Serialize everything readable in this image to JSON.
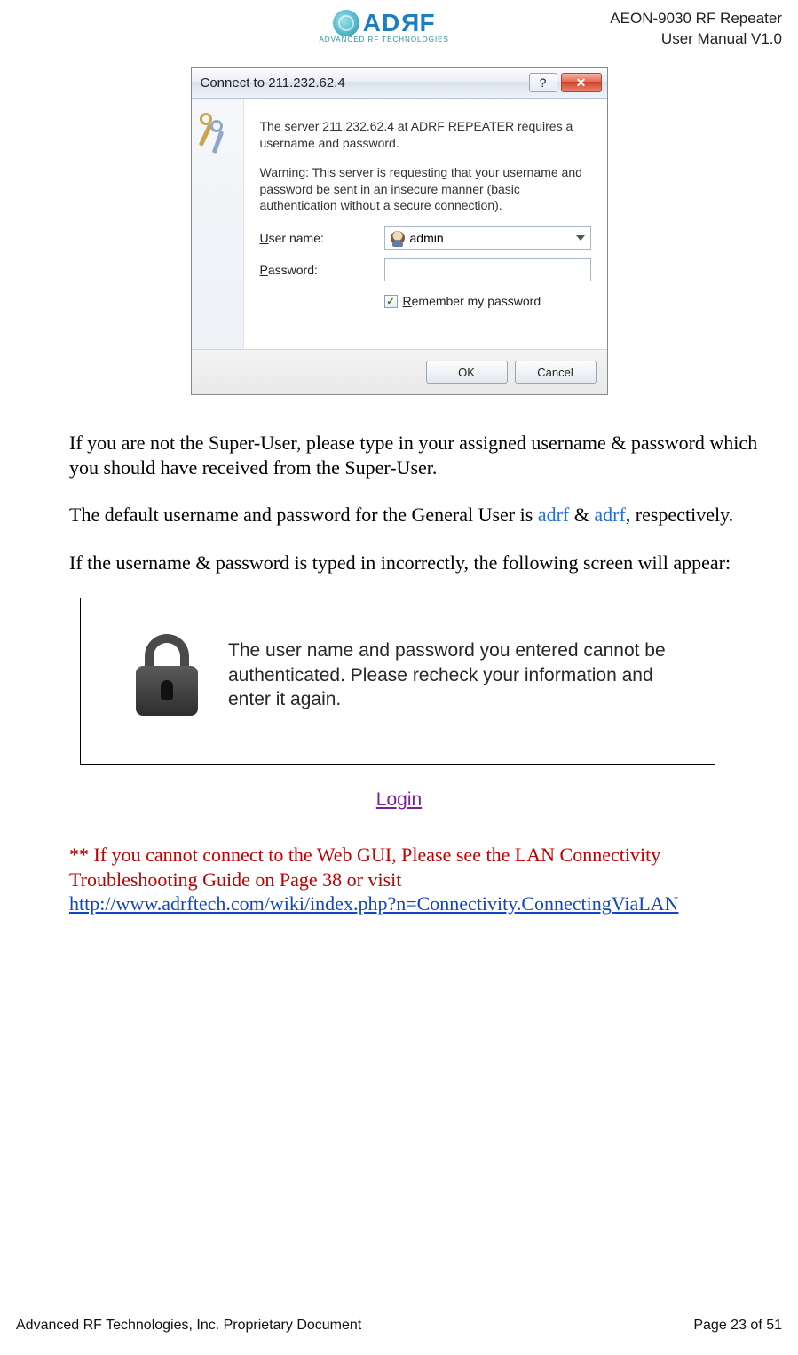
{
  "header": {
    "logo_text": "ADRF",
    "logo_sub": "ADVANCED RF TECHNOLOGIES",
    "line1": "AEON-9030 RF Repeater",
    "line2": "User Manual V1.0"
  },
  "dialog": {
    "title": "Connect to 211.232.62.4",
    "msg1": "The server 211.232.62.4 at ADRF REPEATER requires a username and password.",
    "msg2": "Warning: This server is requesting that your username and password be sent in an insecure manner (basic authentication without a secure connection).",
    "username_label": "User name:",
    "username_value": "admin",
    "password_label": "Password:",
    "password_value": "",
    "remember_label": "Remember my password",
    "ok": "OK",
    "cancel": "Cancel"
  },
  "body": {
    "p1": "If you are not the Super-User, please type in your assigned username & password which you should have received from the Super-User.",
    "p2a": "The default username and password for the General User is ",
    "p2_user": "adrf",
    "p2_amp": " & ",
    "p2_pass": "adrf",
    "p2b": ", respectively.",
    "p3": "If the username & password is typed in incorrectly, the following screen will appear:"
  },
  "error_panel": {
    "text": "The user name and password you entered cannot be authenticated. Please recheck your information and enter it again."
  },
  "login_link": "Login",
  "trouble": {
    "line1": "** If you cannot connect to the Web GUI, Please see the LAN Connectivity Troubleshooting Guide on Page 38 or visit",
    "url": "http://www.adrftech.com/wiki/index.php?n=Connectivity.ConnectingViaLAN"
  },
  "footer": {
    "left": "Advanced RF Technologies, Inc. Proprietary Document",
    "right": "Page 23 of 51"
  }
}
